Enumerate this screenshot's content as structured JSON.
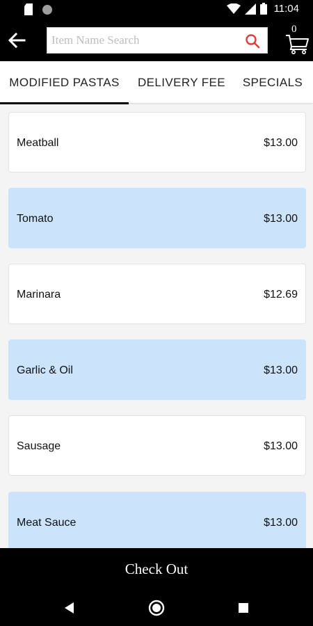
{
  "status_bar": {
    "time": "11:04",
    "icons": [
      "sd-card-icon",
      "circle-notification-icon",
      "wifi-icon",
      "signal-icon",
      "battery-icon"
    ]
  },
  "app_bar": {
    "back_icon": "arrow-left-icon",
    "search": {
      "placeholder": "Item Name Search",
      "value": "",
      "icon": "search-icon",
      "icon_color": "#e53935"
    },
    "cart": {
      "count": "0",
      "icon": "cart-icon"
    }
  },
  "tabs": [
    {
      "label": "MODIFIED PASTAS",
      "active": true
    },
    {
      "label": "DELIVERY FEE",
      "active": false
    },
    {
      "label": "SPECIALS",
      "active": false
    }
  ],
  "items": [
    {
      "name": "Meatball",
      "price": "$13.00",
      "highlighted": false
    },
    {
      "name": "Tomato",
      "price": "$13.00",
      "highlighted": true
    },
    {
      "name": "Marinara",
      "price": "$12.69",
      "highlighted": false
    },
    {
      "name": "Garlic & Oil",
      "price": "$13.00",
      "highlighted": true
    },
    {
      "name": "Sausage",
      "price": "$13.00",
      "highlighted": false
    },
    {
      "name": "Meat Sauce",
      "price": "$13.00",
      "highlighted": true
    }
  ],
  "checkout": {
    "label": "Check Out"
  },
  "nav_bar": {
    "icons": [
      "back-triangle-icon",
      "home-circle-icon",
      "recents-square-icon"
    ]
  },
  "colors": {
    "bar_background": "#000000",
    "highlight_row": "#cbe3fb",
    "search_icon": "#e53935"
  }
}
